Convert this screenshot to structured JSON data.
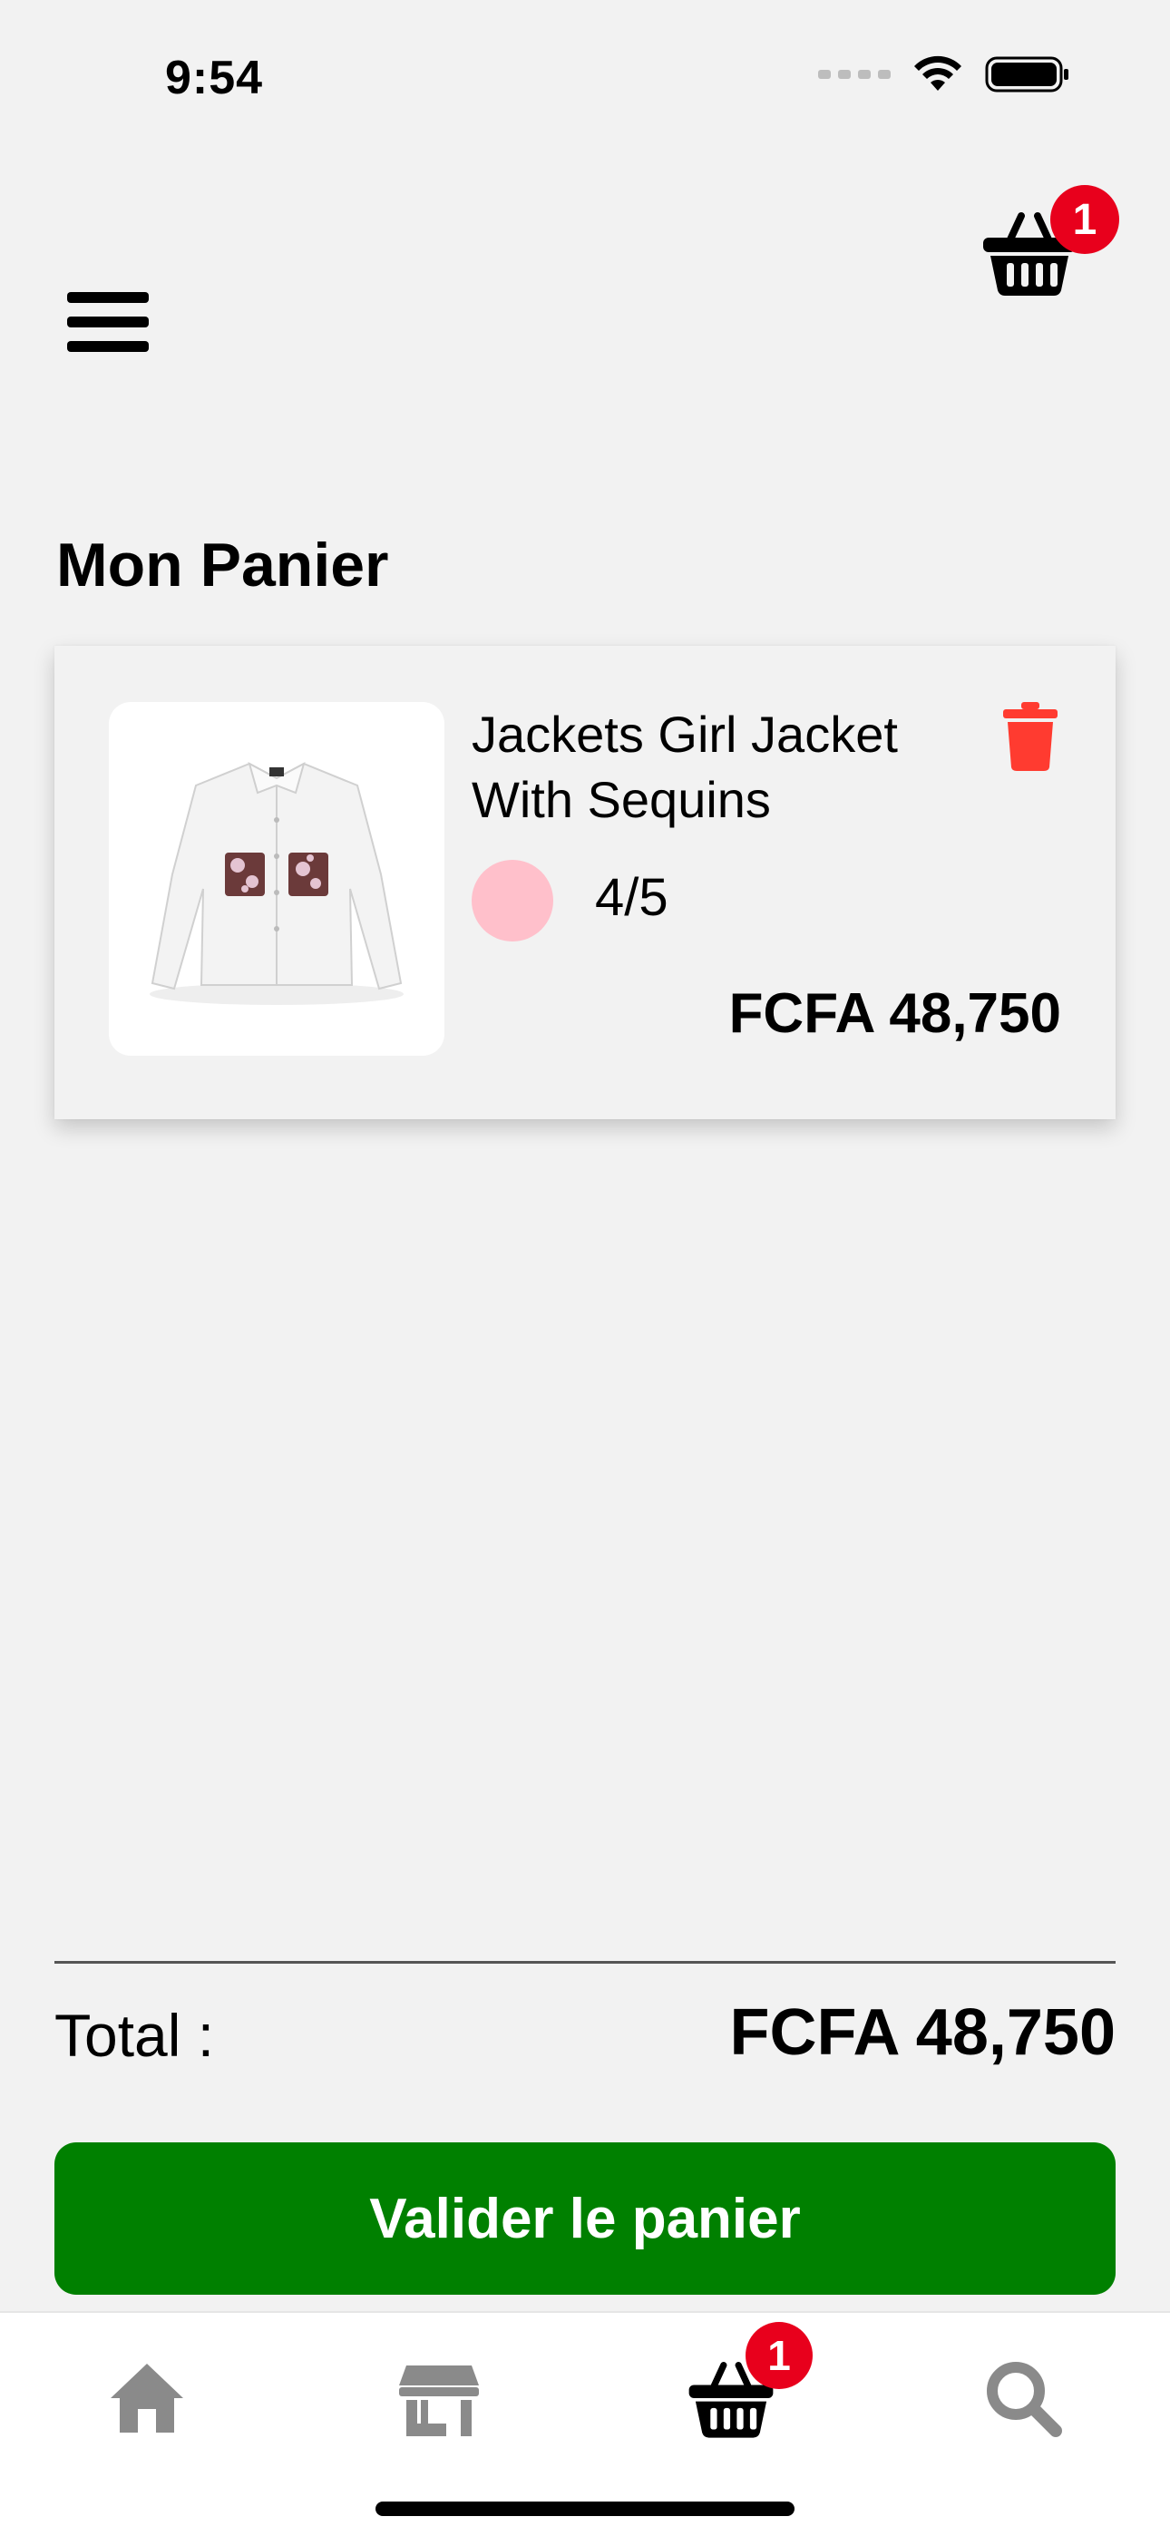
{
  "status_bar": {
    "time": "9:54"
  },
  "header": {
    "cart_badge": "1"
  },
  "page": {
    "title": "Mon Panier"
  },
  "cart_items": [
    {
      "name": "Jackets Girl Jacket With Sequins",
      "color": "#ffc0cb",
      "size": "4/5",
      "price": "FCFA 48,750"
    }
  ],
  "footer": {
    "total_label": "Total :",
    "total_value": "FCFA 48,750",
    "validate_label": "Valider le panier"
  },
  "tab_bar": {
    "tabs": [
      {
        "icon": "home-icon"
      },
      {
        "icon": "store-icon"
      },
      {
        "icon": "cart-icon",
        "badge": "1",
        "active": true
      },
      {
        "icon": "search-icon"
      }
    ]
  },
  "colors": {
    "accent_green": "#008000",
    "badge_red": "#e8001c",
    "delete_red": "#ff3b30",
    "inactive_icon": "#8a8a8a",
    "background": "#f2f2f2"
  }
}
